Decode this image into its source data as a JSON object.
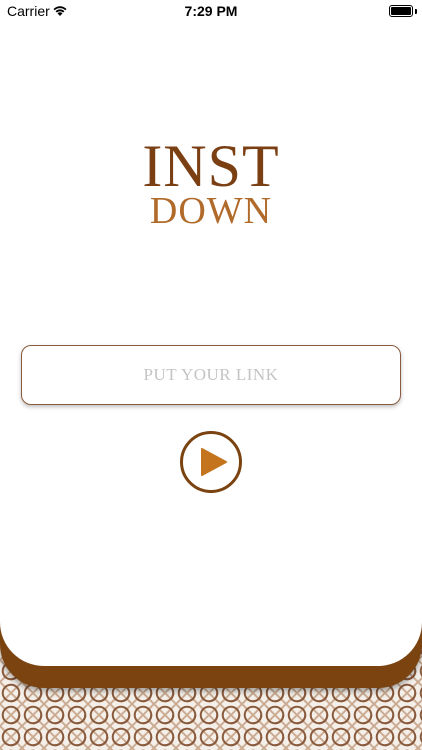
{
  "status_bar": {
    "carrier": "Carrier",
    "time": "7:29 PM",
    "icons": [
      "wifi-icon",
      "battery-icon"
    ]
  },
  "logo": {
    "line1": "INST",
    "line2": "DOWN"
  },
  "link_input": {
    "placeholder": "PUT YOUR LINK",
    "value": ""
  },
  "play_button": {
    "icon": "play-icon"
  },
  "colors": {
    "primary_brown": "#7a4310",
    "accent_brown": "#b06a2a",
    "border_brown": "#8a5a3c",
    "background": "#ffffff"
  }
}
